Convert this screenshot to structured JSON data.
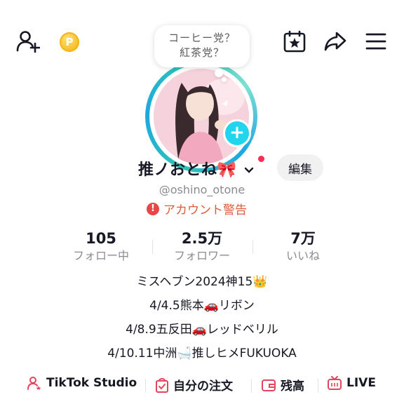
{
  "top_bar": {
    "add_friend_icon": "person-add-icon",
    "coin_icon": "coin-icon",
    "coin_letter": "P",
    "calendar_icon": "calendar-star-icon",
    "share_icon": "share-arrow-icon",
    "menu_icon": "hamburger-menu-icon"
  },
  "bubble": {
    "line1": "コーヒー党？",
    "line2": "紅茶党？"
  },
  "avatar": {
    "plus": "+"
  },
  "profile": {
    "name": "推ノおとね🎀",
    "handle": "@oshino_otone",
    "edit_label": "編集",
    "warning_label": "アカウント警告",
    "warning_mark": "!"
  },
  "stats": [
    {
      "value": "105",
      "label": "フォロー中"
    },
    {
      "value": "2.5万",
      "label": "フォロワー"
    },
    {
      "value": "7万",
      "label": "いいね"
    }
  ],
  "bio": [
    "ミスヘブン2024神15👑",
    "4/4.5熊本🚗リボン",
    "4/8.9五反田🚗レッドベリル",
    "4/10.11中洲🛁推しヒメFUKUOKA"
  ],
  "links": [
    {
      "label": "TikTok Studio",
      "icon": "studio-person-icon"
    },
    {
      "label": "自分の注文",
      "icon": "order-bag-icon"
    },
    {
      "label": "残高",
      "icon": "wallet-icon"
    },
    {
      "label": "LIVE",
      "icon": "live-tv-icon"
    }
  ],
  "colors": {
    "accent": "#fe2c55",
    "ring": "#20d5ec",
    "warning": "#e05b3c"
  }
}
